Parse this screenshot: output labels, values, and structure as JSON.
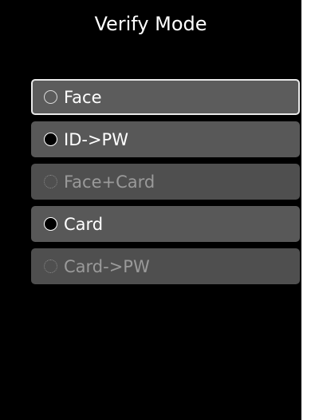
{
  "header": {
    "title": "Verify Mode"
  },
  "options": [
    {
      "label": "Face",
      "state": "selected",
      "icon": "radio-hollow-icon"
    },
    {
      "label": "ID->PW",
      "state": "enabled",
      "icon": "radio-filled-icon"
    },
    {
      "label": "Face+Card",
      "state": "disabled",
      "icon": "radio-dotted-icon"
    },
    {
      "label": "Card",
      "state": "enabled",
      "icon": "radio-filled-icon"
    },
    {
      "label": "Card->PW",
      "state": "disabled",
      "icon": "radio-dotted-icon"
    }
  ],
  "colors": {
    "background": "#000000",
    "option_bg": "#585858",
    "selected_border": "#e9e9e9",
    "disabled_text": "#9a9a9a"
  }
}
